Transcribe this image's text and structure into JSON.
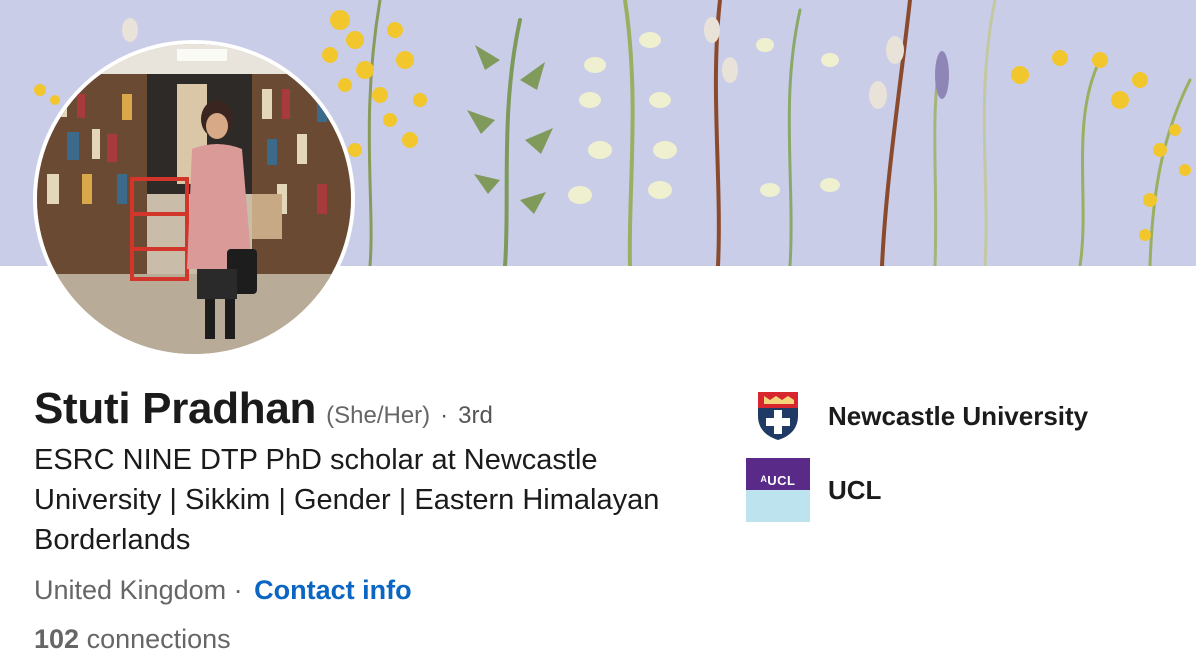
{
  "profile": {
    "name": "Stuti Pradhan",
    "pronouns": "(She/Her)",
    "separator": "·",
    "degree": "3rd",
    "headline": "ESRC NINE DTP PhD scholar at Newcastle University | Sikkim | Gender | Eastern Himalayan Borderlands",
    "location": "United Kingdom",
    "contact_separator": "·",
    "contact_label": "Contact info",
    "connections_count": "102",
    "connections_label": "connections"
  },
  "education": [
    {
      "name": "Newcastle University",
      "logo_icon": "newcastle-university-crest-icon"
    },
    {
      "name": "UCL",
      "logo_text": "ᴬUCL",
      "logo_icon": "ucl-logo-icon"
    }
  ],
  "colors": {
    "link": "#0a66c2",
    "banner_bg": "#c9cde8",
    "ucl_purple": "#5a2a88",
    "ucl_light": "#bde3ef"
  }
}
